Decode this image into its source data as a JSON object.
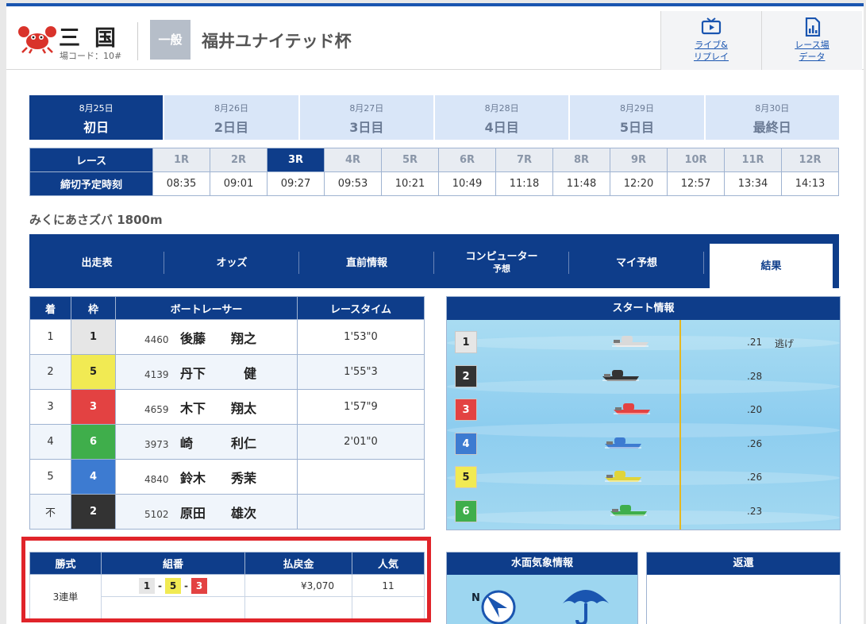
{
  "header": {
    "venue_name": "三国",
    "venue_code": "場コード：10#",
    "grade": "一般",
    "race_title": "福井ユナイテッド杯",
    "links": [
      {
        "label_line1": "ライブ&",
        "label_line2": "リプレイ",
        "icon": "tv-icon"
      },
      {
        "label_line1": "レース場",
        "label_line2": "データ",
        "icon": "document-chart-icon"
      }
    ]
  },
  "days": [
    {
      "date": "8月25日",
      "name": "初日",
      "active": true
    },
    {
      "date": "8月26日",
      "name": "2日目"
    },
    {
      "date": "8月27日",
      "name": "3日目"
    },
    {
      "date": "8月28日",
      "name": "4日目"
    },
    {
      "date": "8月29日",
      "name": "5日目"
    },
    {
      "date": "8月30日",
      "name": "最終日"
    }
  ],
  "races": {
    "race_header": "レース",
    "deadline_header": "締切予定時刻",
    "list": [
      {
        "label": "1R",
        "time": "08:35"
      },
      {
        "label": "2R",
        "time": "09:01"
      },
      {
        "label": "3R",
        "time": "09:27",
        "active": true
      },
      {
        "label": "4R",
        "time": "09:53"
      },
      {
        "label": "5R",
        "time": "10:21"
      },
      {
        "label": "6R",
        "time": "10:49"
      },
      {
        "label": "7R",
        "time": "11:18"
      },
      {
        "label": "8R",
        "time": "11:48"
      },
      {
        "label": "9R",
        "time": "12:20"
      },
      {
        "label": "10R",
        "time": "12:57"
      },
      {
        "label": "11R",
        "time": "13:34"
      },
      {
        "label": "12R",
        "time": "14:13"
      }
    ]
  },
  "course_name": "みくにあさズバ 1800m",
  "nav_tabs": [
    {
      "label": "出走表"
    },
    {
      "label": "オッズ"
    },
    {
      "label": "直前情報"
    },
    {
      "label": "コンピューター",
      "sub": "予想"
    },
    {
      "label": "マイ予想"
    },
    {
      "label": "結果",
      "active": true
    }
  ],
  "results": {
    "headers": [
      "着",
      "枠",
      "ボートレーサー",
      "レースタイム"
    ],
    "rows": [
      {
        "place": "1",
        "waku": "1",
        "reg": "4460",
        "name": "後藤　　翔之",
        "time": "1'53\"0"
      },
      {
        "place": "2",
        "waku": "5",
        "reg": "4139",
        "name": "丹下　　　健",
        "time": "1'55\"3"
      },
      {
        "place": "3",
        "waku": "3",
        "reg": "4659",
        "name": "木下　　翔太",
        "time": "1'57\"9"
      },
      {
        "place": "4",
        "waku": "6",
        "reg": "3973",
        "name": "崎　　　利仁",
        "time": "2'01\"0"
      },
      {
        "place": "5",
        "waku": "4",
        "reg": "4840",
        "name": "鈴木　　秀茉",
        "time": ""
      },
      {
        "place": "不",
        "waku": "2",
        "reg": "5102",
        "name": "原田　　雄次",
        "time": ""
      }
    ]
  },
  "start_info": {
    "title": "スタート情報",
    "lanes": [
      {
        "lane": "1",
        "st": ".21",
        "kimarite": "逃げ",
        "color": "#d9d9d9"
      },
      {
        "lane": "2",
        "st": ".28",
        "kimarite": "",
        "color": "#333333"
      },
      {
        "lane": "3",
        "st": ".20",
        "kimarite": "",
        "color": "#e34242"
      },
      {
        "lane": "4",
        "st": ".26",
        "kimarite": "",
        "color": "#3d7bd1"
      },
      {
        "lane": "5",
        "st": ".26",
        "kimarite": "",
        "color": "#e0d43a"
      },
      {
        "lane": "6",
        "st": ".23",
        "kimarite": "",
        "color": "#3fae4b"
      }
    ]
  },
  "payout": {
    "headers": [
      "勝式",
      "組番",
      "払戻金",
      "人気"
    ],
    "bet_type": "3連単",
    "combo": [
      "1",
      "5",
      "3"
    ],
    "amount": "¥3,070",
    "popularity": "11"
  },
  "weather": {
    "title": "水面気象情報",
    "wind_direction": "N"
  },
  "refund": {
    "title": "返還"
  }
}
